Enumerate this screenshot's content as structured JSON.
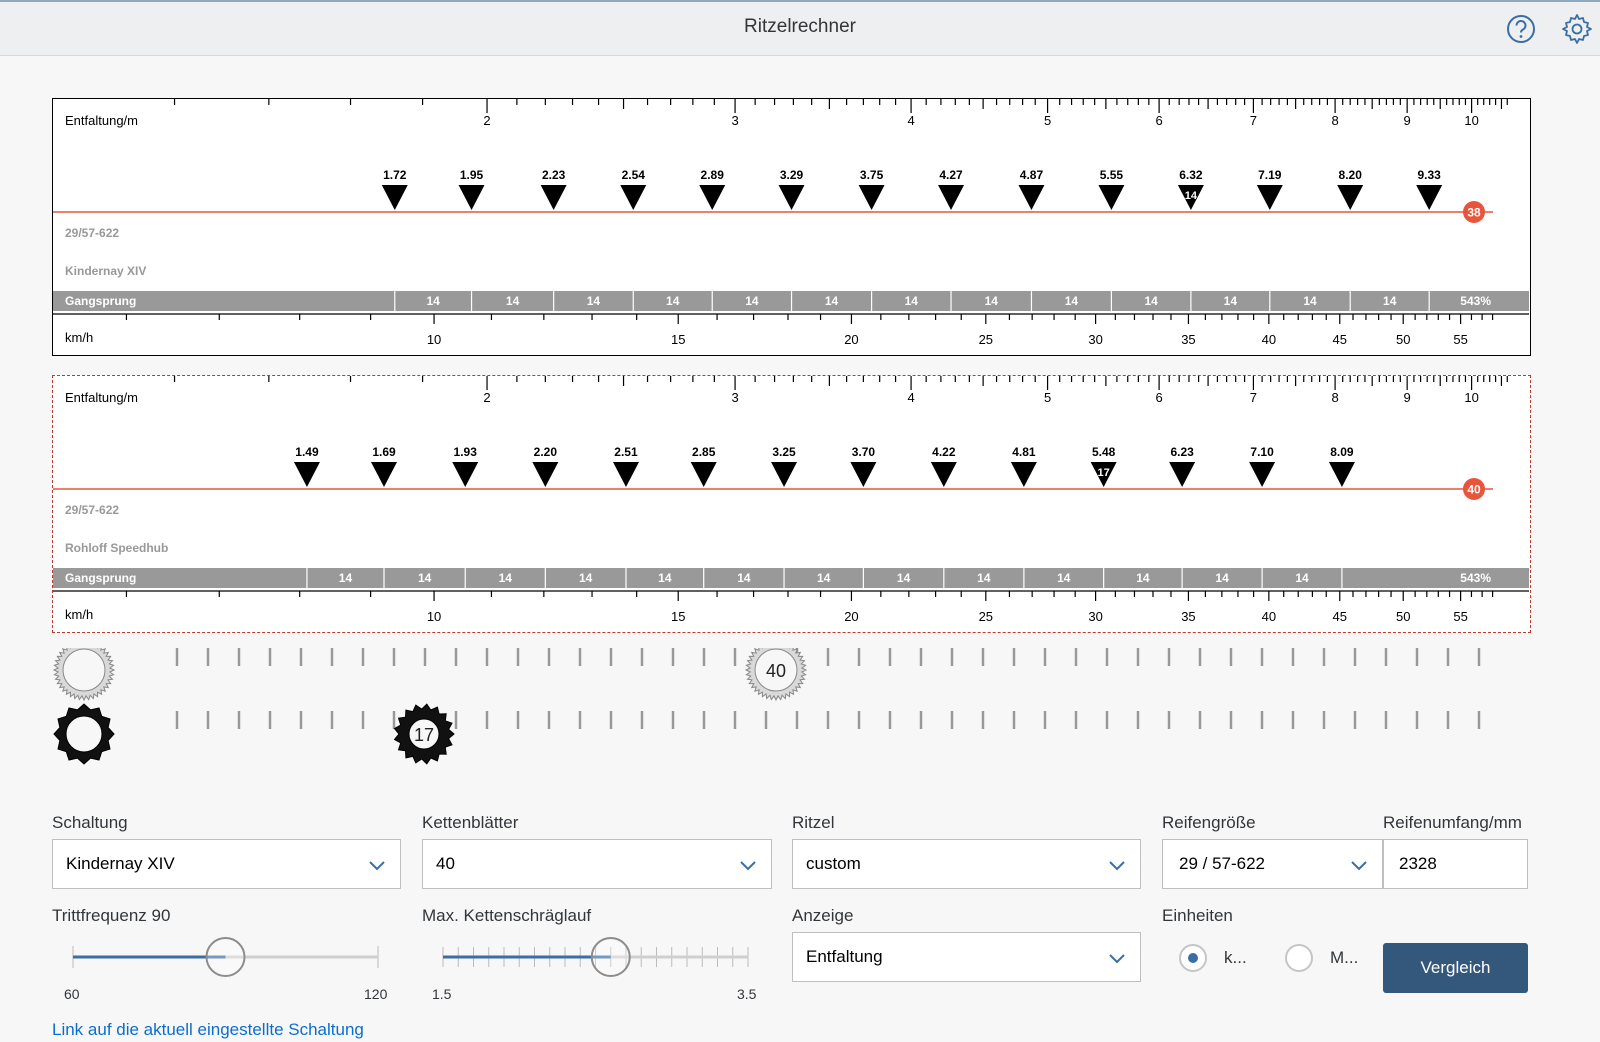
{
  "header": {
    "title": "Ritzelrechner",
    "help_icon": "help-icon",
    "settings_icon": "gear-icon"
  },
  "ruler": {
    "entfaltung_label": "Entfaltung/m",
    "entfaltung_ticks": [
      "2",
      "3",
      "4",
      "5",
      "6",
      "7",
      "8",
      "9",
      "10"
    ],
    "kmh_label": "km/h",
    "kmh_ticks": [
      "10",
      "15",
      "20",
      "25",
      "30",
      "35",
      "40",
      "45",
      "50",
      "55"
    ],
    "gangsprung_label": "Gangsprung"
  },
  "panels": [
    {
      "tire": "29/57-622",
      "hub": "Kindernay XIV",
      "ring": "38",
      "gears": [
        "1.72",
        "1.95",
        "2.23",
        "2.54",
        "2.89",
        "3.29",
        "3.75",
        "4.27",
        "4.87",
        "5.55",
        "6.32",
        "7.19",
        "8.20",
        "9.33"
      ],
      "highlight_index": 10,
      "highlight_label": "14",
      "steps": [
        "14",
        "14",
        "14",
        "14",
        "14",
        "14",
        "14",
        "14",
        "14",
        "14",
        "14",
        "14",
        "14"
      ],
      "range": "543%"
    },
    {
      "tire": "29/57-622",
      "hub": "Rohloff Speedhub",
      "ring": "40",
      "gears": [
        "1.49",
        "1.69",
        "1.93",
        "2.20",
        "2.51",
        "2.85",
        "3.25",
        "3.70",
        "4.22",
        "4.81",
        "5.48",
        "6.23",
        "7.10",
        "8.09"
      ],
      "highlight_index": 10,
      "highlight_label": "17",
      "steps": [
        "14",
        "14",
        "14",
        "14",
        "14",
        "14",
        "14",
        "14",
        "14",
        "14",
        "14",
        "14",
        "14"
      ],
      "range": "543%"
    }
  ],
  "chainring_selector": {
    "selected": "40"
  },
  "sprocket_selector": {
    "selected": "17"
  },
  "form": {
    "schaltung": {
      "label": "Schaltung",
      "value": "Kindernay XIV"
    },
    "kettenblaetter": {
      "label": "Kettenblätter",
      "value": "40"
    },
    "ritzel": {
      "label": "Ritzel",
      "value": "custom"
    },
    "reifengroesse": {
      "label": "Reifengröße",
      "value": "29 / 57-622"
    },
    "reifenumfang": {
      "label": "Reifenumfang/mm",
      "value": "2328"
    },
    "trittfrequenz": {
      "label": "Trittfrequenz 90",
      "min": "60",
      "max": "120",
      "value": 90
    },
    "schraeglauf": {
      "label": "Max. Kettenschräglauf",
      "min": "1.5",
      "max": "3.5",
      "value": 2.6
    },
    "anzeige": {
      "label": "Anzeige",
      "value": "Entfaltung"
    },
    "einheiten": {
      "label": "Einheiten",
      "option1": "k...",
      "option2": "M..."
    },
    "vergleich": "Vergleich",
    "link": "Link auf die aktuell eingestellte Schaltung"
  },
  "colors": {
    "accent": "#e8553a",
    "brand_button": "#34587c",
    "link": "#0a6ed1",
    "bar": "#999999"
  }
}
